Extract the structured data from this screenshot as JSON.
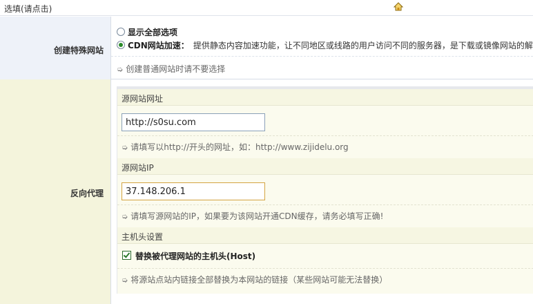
{
  "header": {
    "title": "选填(请点击)",
    "home_icon": "home-icon"
  },
  "special_site": {
    "label": "创建特殊网站",
    "option_all": "显示全部选项",
    "option_cdn_name": "CDN网站加速：",
    "option_cdn_desc": "提供静态内容加速功能，让不同地区或线路的用户访问不同的服务器，是下载或镜像网站的解",
    "hint": "创建普通网站时请不要选择",
    "selected": "cdn"
  },
  "reverse_proxy": {
    "label": "反向代理",
    "source_url": {
      "heading": "源网站网址",
      "value": "http://s0su.com",
      "hint": "请填写以http://开头的网址，如：http://www.zijidelu.org"
    },
    "source_ip": {
      "heading": "源网站IP",
      "value": "37.148.206.1",
      "hint": "请填写源网站的IP，如果要为该网站开通CDN缓存，请务必填写正确!"
    },
    "host_header": {
      "heading": "主机头设置",
      "checkbox_label": "替换被代理网站的主机头(Host)",
      "checked": true,
      "hint": "将源站点站内链接全部替换为本网站的链接（某些网站可能无法替换）"
    }
  },
  "colors": {
    "label_blue_bg": "#eef2f9",
    "label_yellow_bg": "#f4f4dc",
    "content_yellow_bg": "#fbfbee",
    "radio_selected": "#2a8a2a",
    "ip_input_border": "#d4a440"
  }
}
